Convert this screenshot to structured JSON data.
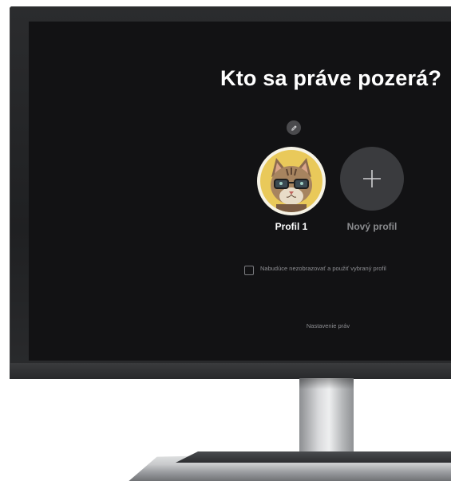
{
  "screen": {
    "title": "Kto sa práve pozerá?",
    "profiles": [
      {
        "label": "Profil 1",
        "avatar": "cat-with-glasses-avatar"
      }
    ],
    "new_profile_label": "Nový profil",
    "new_profile_icon": "plus-icon",
    "edit_icon": "pencil-icon",
    "remember_checkbox": {
      "label": "Nabudúce nezobrazovať a použiť vybraný profil",
      "checked": false
    },
    "settings_link": "Nastavenie práv"
  },
  "colors": {
    "screen_bg": "#121214",
    "avatar_bg": "#e9c95a",
    "add_button_bg": "#3a3b3e",
    "text_primary": "#ffffff",
    "text_muted": "#8e8f93"
  }
}
